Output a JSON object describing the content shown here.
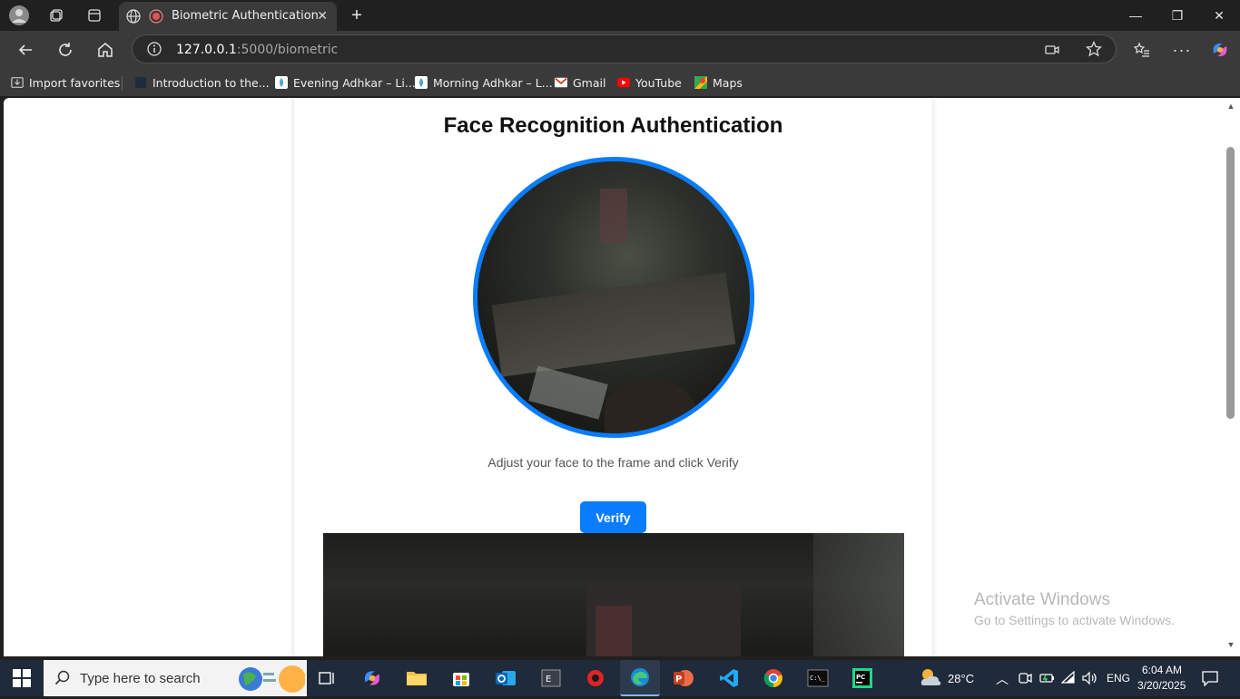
{
  "browser": {
    "tab_title": "Biometric Authentication",
    "address_host": "127.0.0.1",
    "address_rest": ":5000/biometric",
    "bookmarks": [
      {
        "label": "Import favorites",
        "icon": "import-icon"
      },
      {
        "label": "Introduction to the...",
        "icon": "page-icon"
      },
      {
        "label": "Evening Adhkar – Li...",
        "icon": "drop-icon"
      },
      {
        "label": "Morning Adhkar – L...",
        "icon": "drop-icon"
      },
      {
        "label": "Gmail",
        "icon": "gmail-icon"
      },
      {
        "label": "YouTube",
        "icon": "youtube-icon"
      },
      {
        "label": "Maps",
        "icon": "maps-icon"
      }
    ]
  },
  "page": {
    "title": "Face Recognition Authentication",
    "instruction": "Adjust your face to the frame and click Verify",
    "verify_label": "Verify",
    "accent": "#0a7cff"
  },
  "watermark": {
    "line1": "Activate Windows",
    "line2": "Go to Settings to activate Windows."
  },
  "taskbar": {
    "search_placeholder": "Type here to search",
    "weather": "28°C",
    "lang": "ENG",
    "time": "6:04 AM",
    "date": "3/20/2025"
  }
}
